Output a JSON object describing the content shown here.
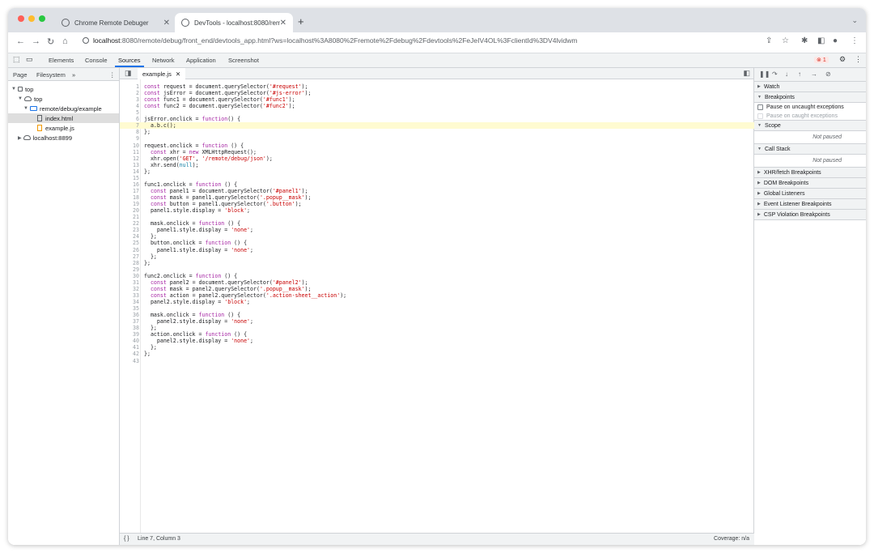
{
  "browser": {
    "tabs": [
      {
        "title": "Chrome Remote Debuger",
        "active": false
      },
      {
        "title": "DevTools - localhost:8080/rem",
        "active": true
      }
    ],
    "new_tab": "+",
    "url_host": "localhost",
    "url_rest": ":8080/remote/debug/front_end/devtools_app.html?ws=localhost%3A8080%2Fremote%2Fdebug%2Fdevtools%2FeJeIV4OL%3FclientId%3DV4lvidwm"
  },
  "devtools": {
    "tabs": [
      "Elements",
      "Console",
      "Sources",
      "Network",
      "Application",
      "Screenshot"
    ],
    "active_tab": "Sources",
    "error_count": "1"
  },
  "navigator": {
    "tabs": [
      "Page",
      "Filesystem"
    ],
    "more": "»",
    "tree": [
      {
        "label": "top",
        "type": "frame",
        "depth": 0
      },
      {
        "label": "top",
        "type": "cloud",
        "depth": 1
      },
      {
        "label": "remote/debug/example",
        "type": "folder",
        "depth": 2
      },
      {
        "label": "index.html",
        "type": "file",
        "depth": 3,
        "selected": true
      },
      {
        "label": "example.js",
        "type": "js",
        "depth": 3
      },
      {
        "label": "localhost:8899",
        "type": "cloud",
        "depth": 1
      }
    ]
  },
  "editor": {
    "file_tab": "example.js",
    "highlight_line": 7,
    "lines": [
      "const request = document.querySelector('#request');",
      "const jsError = document.querySelector('#js-error');",
      "const func1 = document.querySelector('#func1');",
      "const func2 = document.querySelector('#func2');",
      "",
      "jsError.onclick = function() {",
      "  a.b.c();",
      "};",
      "",
      "request.onclick = function () {",
      "  const xhr = new XMLHttpRequest();",
      "  xhr.open('GET', '/remote/debug/json');",
      "  xhr.send(null);",
      "};",
      "",
      "func1.onclick = function () {",
      "  const panel1 = document.querySelector('#panel1');",
      "  const mask = panel1.querySelector('.popup__mask');",
      "  const button = panel1.querySelector('.button');",
      "  panel1.style.display = 'block';",
      "",
      "  mask.onclick = function () {",
      "    panel1.style.display = 'none';",
      "  };",
      "  button.onclick = function () {",
      "    panel1.style.display = 'none';",
      "  };",
      "};",
      "",
      "func2.onclick = function () {",
      "  const panel2 = document.querySelector('#panel2');",
      "  const mask = panel2.querySelector('.popup__mask');",
      "  const action = panel2.querySelector('.action-sheet__action');",
      "  panel2.style.display = 'block';",
      "",
      "  mask.onclick = function () {",
      "    panel2.style.display = 'none';",
      "  };",
      "  action.onclick = function () {",
      "    panel2.style.display = 'none';",
      "  };",
      "};",
      ""
    ],
    "status_left": "Line 7, Column 3",
    "status_right": "Coverage: n/a",
    "status_icon": "{ }"
  },
  "debugger": {
    "sections": [
      {
        "label": "Watch",
        "open": false
      },
      {
        "label": "Breakpoints",
        "open": true
      },
      {
        "label": "Scope",
        "open": true
      },
      {
        "label": "Call Stack",
        "open": true
      },
      {
        "label": "XHR/fetch Breakpoints",
        "open": false
      },
      {
        "label": "DOM Breakpoints",
        "open": false
      },
      {
        "label": "Global Listeners",
        "open": false
      },
      {
        "label": "Event Listener Breakpoints",
        "open": false
      },
      {
        "label": "CSP Violation Breakpoints",
        "open": false
      }
    ],
    "pause_uncaught": "Pause on uncaught exceptions",
    "pause_caught": "Pause on caught exceptions",
    "not_paused": "Not paused"
  }
}
